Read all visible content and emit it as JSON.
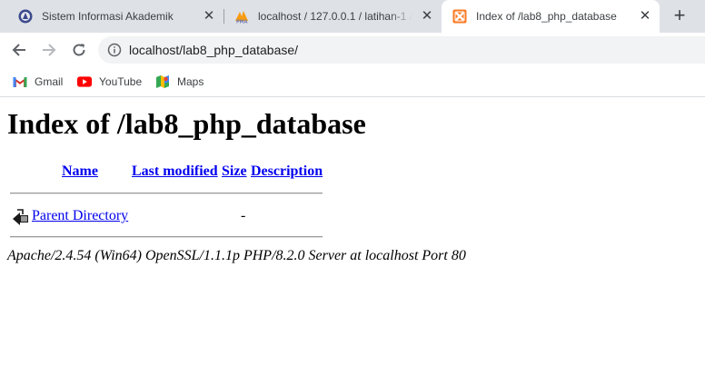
{
  "browser": {
    "tabs": [
      {
        "title": "Sistem Informasi Akademik",
        "icon": "university-logo-icon",
        "active": false
      },
      {
        "title": "localhost / 127.0.0.1 / latihan-1 / ",
        "icon": "phpmyadmin-icon",
        "active": false
      },
      {
        "title": "Index of /lab8_php_database",
        "icon": "xampp-icon",
        "active": true
      }
    ],
    "close_glyph": "✕",
    "new_tab_glyph": "+",
    "address_bar": {
      "url": "localhost/lab8_php_database/"
    },
    "bookmarks": [
      {
        "label": "Gmail",
        "icon": "gmail-icon"
      },
      {
        "label": "YouTube",
        "icon": "youtube-icon"
      },
      {
        "label": "Maps",
        "icon": "maps-icon"
      }
    ]
  },
  "page": {
    "title": "Index of /lab8_php_database",
    "columns": [
      "Name",
      "Last modified",
      "Size",
      "Description"
    ],
    "rows": [
      {
        "name": "Parent Directory",
        "last_modified": "",
        "size": "-",
        "description": "",
        "icon": "parent-directory-icon"
      }
    ],
    "footer": "Apache/2.4.54 (Win64) OpenSSL/1.1.1p PHP/8.2.0 Server at localhost Port 80"
  },
  "colors": {
    "tabstrip": "#dee1e6",
    "link": "#0000ee",
    "omnibox": "#f1f3f4"
  }
}
